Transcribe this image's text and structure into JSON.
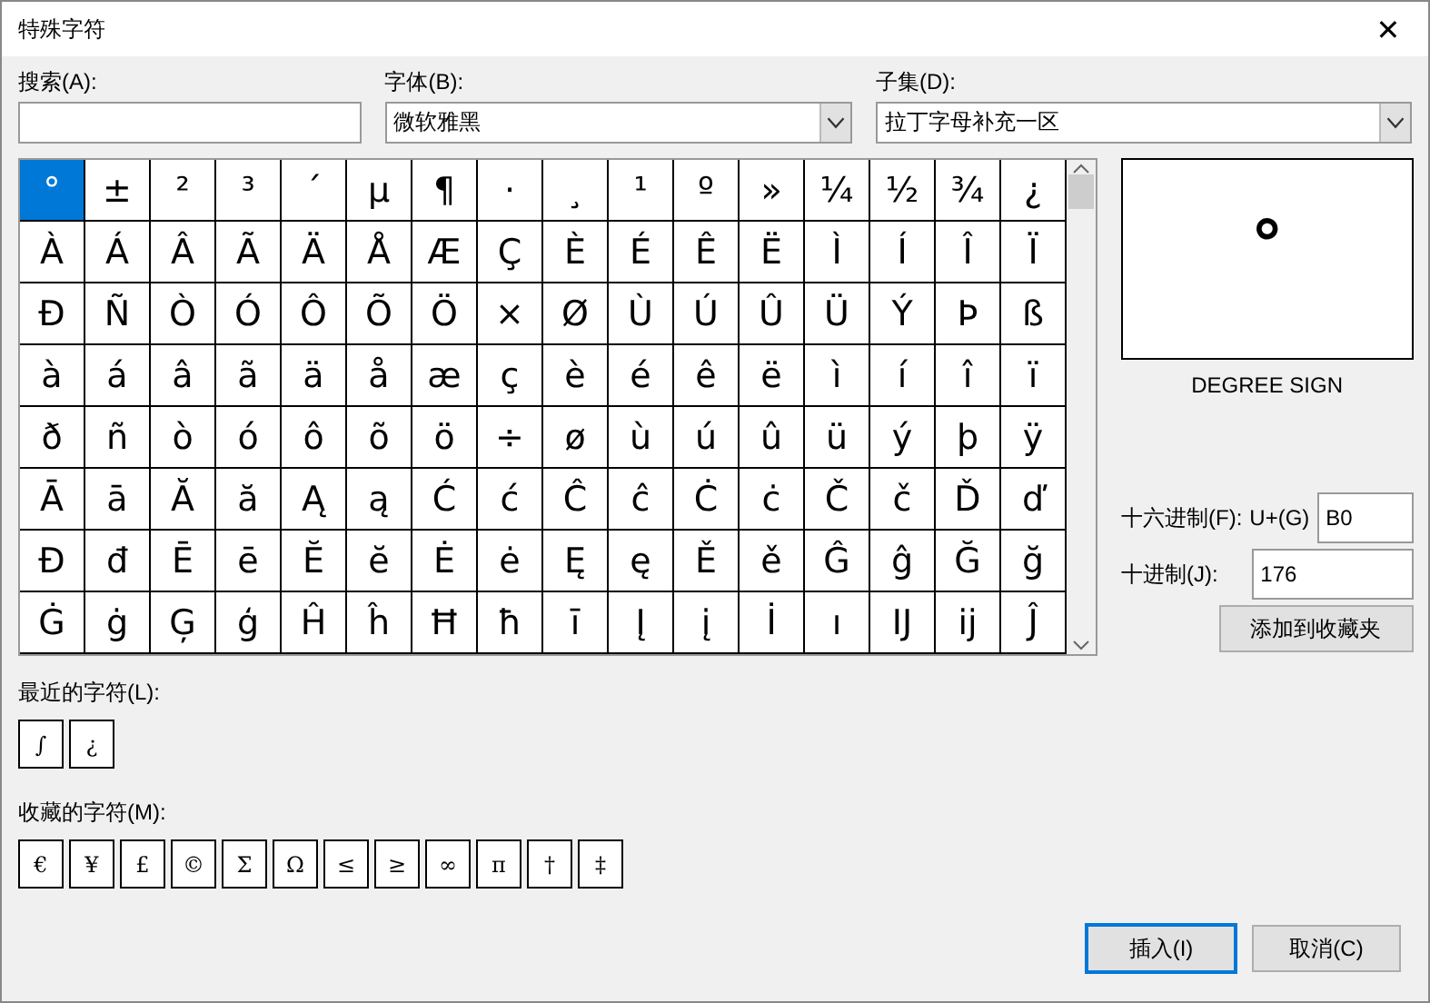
{
  "window": {
    "title": "特殊字符",
    "close": "✕"
  },
  "search": {
    "label": "搜索(A):"
  },
  "font": {
    "label": "字体(B):",
    "value": "微软雅黑"
  },
  "subset": {
    "label": "子集(D):",
    "value": "拉丁字母补充一区"
  },
  "grid": {
    "rows": [
      [
        {
          "char": "°",
          "selected": true
        },
        {
          "char": "±",
          "selected": false
        },
        {
          "char": "²",
          "selected": false
        },
        {
          "char": "³",
          "selected": false
        },
        {
          "char": "´",
          "selected": false
        },
        {
          "char": "µ",
          "selected": false
        },
        {
          "char": "¶",
          "selected": false
        },
        {
          "char": "·",
          "selected": false
        },
        {
          "char": "¸",
          "selected": false
        },
        {
          "char": "¹",
          "selected": false
        },
        {
          "char": "º",
          "selected": false
        },
        {
          "char": "»",
          "selected": false
        },
        {
          "char": "¼",
          "selected": false
        },
        {
          "char": "½",
          "selected": false
        },
        {
          "char": "¾",
          "selected": false
        },
        {
          "char": "¿",
          "selected": false
        }
      ],
      [
        {
          "char": "À",
          "selected": false
        },
        {
          "char": "Á",
          "selected": false
        },
        {
          "char": "Â",
          "selected": false
        },
        {
          "char": "Ã",
          "selected": false
        },
        {
          "char": "Ä",
          "selected": false
        },
        {
          "char": "Å",
          "selected": false
        },
        {
          "char": "Æ",
          "selected": false
        },
        {
          "char": "Ç",
          "selected": false
        },
        {
          "char": "È",
          "selected": false
        },
        {
          "char": "É",
          "selected": false
        },
        {
          "char": "Ê",
          "selected": false
        },
        {
          "char": "Ë",
          "selected": false
        },
        {
          "char": "Ì",
          "selected": false
        },
        {
          "char": "Í",
          "selected": false
        },
        {
          "char": "Î",
          "selected": false
        },
        {
          "char": "Ï",
          "selected": false
        }
      ],
      [
        {
          "char": "Ð",
          "selected": false
        },
        {
          "char": "Ñ",
          "selected": false
        },
        {
          "char": "Ò",
          "selected": false
        },
        {
          "char": "Ó",
          "selected": false
        },
        {
          "char": "Ô",
          "selected": false
        },
        {
          "char": "Õ",
          "selected": false
        },
        {
          "char": "Ö",
          "selected": false
        },
        {
          "char": "×",
          "selected": false
        },
        {
          "char": "Ø",
          "selected": false
        },
        {
          "char": "Ù",
          "selected": false
        },
        {
          "char": "Ú",
          "selected": false
        },
        {
          "char": "Û",
          "selected": false
        },
        {
          "char": "Ü",
          "selected": false
        },
        {
          "char": "Ý",
          "selected": false
        },
        {
          "char": "Þ",
          "selected": false
        },
        {
          "char": "ß",
          "selected": false
        }
      ],
      [
        {
          "char": "à",
          "selected": false
        },
        {
          "char": "á",
          "selected": false
        },
        {
          "char": "â",
          "selected": false
        },
        {
          "char": "ã",
          "selected": false
        },
        {
          "char": "ä",
          "selected": false
        },
        {
          "char": "å",
          "selected": false
        },
        {
          "char": "æ",
          "selected": false
        },
        {
          "char": "ç",
          "selected": false
        },
        {
          "char": "è",
          "selected": false
        },
        {
          "char": "é",
          "selected": false
        },
        {
          "char": "ê",
          "selected": false
        },
        {
          "char": "ë",
          "selected": false
        },
        {
          "char": "ì",
          "selected": false
        },
        {
          "char": "í",
          "selected": false
        },
        {
          "char": "î",
          "selected": false
        },
        {
          "char": "ï",
          "selected": false
        }
      ],
      [
        {
          "char": "ð",
          "selected": false
        },
        {
          "char": "ñ",
          "selected": false
        },
        {
          "char": "ò",
          "selected": false
        },
        {
          "char": "ó",
          "selected": false
        },
        {
          "char": "ô",
          "selected": false
        },
        {
          "char": "õ",
          "selected": false
        },
        {
          "char": "ö",
          "selected": false
        },
        {
          "char": "÷",
          "selected": false
        },
        {
          "char": "ø",
          "selected": false
        },
        {
          "char": "ù",
          "selected": false
        },
        {
          "char": "ú",
          "selected": false
        },
        {
          "char": "û",
          "selected": false
        },
        {
          "char": "ü",
          "selected": false
        },
        {
          "char": "ý",
          "selected": false
        },
        {
          "char": "þ",
          "selected": false
        },
        {
          "char": "ÿ",
          "selected": false
        }
      ],
      [
        {
          "char": "Ā",
          "selected": false
        },
        {
          "char": "ā",
          "selected": false
        },
        {
          "char": "Ă",
          "selected": false
        },
        {
          "char": "ă",
          "selected": false
        },
        {
          "char": "Ą",
          "selected": false
        },
        {
          "char": "ą",
          "selected": false
        },
        {
          "char": "Ć",
          "selected": false
        },
        {
          "char": "ć",
          "selected": false
        },
        {
          "char": "Ĉ",
          "selected": false
        },
        {
          "char": "ĉ",
          "selected": false
        },
        {
          "char": "Ċ",
          "selected": false
        },
        {
          "char": "ċ",
          "selected": false
        },
        {
          "char": "Č",
          "selected": false
        },
        {
          "char": "č",
          "selected": false
        },
        {
          "char": "Ď",
          "selected": false
        },
        {
          "char": "ď",
          "selected": false
        }
      ],
      [
        {
          "char": "Đ",
          "selected": false
        },
        {
          "char": "đ",
          "selected": false
        },
        {
          "char": "Ē",
          "selected": false
        },
        {
          "char": "ē",
          "selected": false
        },
        {
          "char": "Ĕ",
          "selected": false
        },
        {
          "char": "ĕ",
          "selected": false
        },
        {
          "char": "Ė",
          "selected": false
        },
        {
          "char": "ė",
          "selected": false
        },
        {
          "char": "Ę",
          "selected": false
        },
        {
          "char": "ę",
          "selected": false
        },
        {
          "char": "Ě",
          "selected": false
        },
        {
          "char": "ě",
          "selected": false
        },
        {
          "char": "Ĝ",
          "selected": false
        },
        {
          "char": "ĝ",
          "selected": false
        },
        {
          "char": "Ğ",
          "selected": false
        },
        {
          "char": "ğ",
          "selected": false
        }
      ],
      [
        {
          "char": "Ġ",
          "selected": false
        },
        {
          "char": "ġ",
          "selected": false
        },
        {
          "char": "Ģ",
          "selected": false
        },
        {
          "char": "ģ",
          "selected": false
        },
        {
          "char": "Ĥ",
          "selected": false
        },
        {
          "char": "ĥ",
          "selected": false
        },
        {
          "char": "Ħ",
          "selected": false
        },
        {
          "char": "ħ",
          "selected": false
        },
        {
          "char": "ī",
          "selected": false
        },
        {
          "char": "Į",
          "selected": false
        },
        {
          "char": "į",
          "selected": false
        },
        {
          "char": "İ",
          "selected": false
        },
        {
          "char": "ı",
          "selected": false
        },
        {
          "char": "Ĳ",
          "selected": false
        },
        {
          "char": "ĳ",
          "selected": false
        },
        {
          "char": "Ĵ",
          "selected": false
        }
      ]
    ]
  },
  "preview": {
    "char": "°",
    "name": "DEGREE SIGN"
  },
  "hex": {
    "label": "十六进制(F):",
    "prefix": "U+(G)",
    "value": "B0"
  },
  "decimal": {
    "label": "十进制(J):",
    "value": "176"
  },
  "add_favorite_button": "添加到收藏夹",
  "recent": {
    "label": "最近的字符(L):",
    "chars": [
      "∫",
      "¿"
    ]
  },
  "favorites": {
    "label": "收藏的字符(M):",
    "chars": [
      "€",
      "¥",
      "£",
      "©",
      "Σ",
      "Ω",
      "≤",
      "≥",
      "∞",
      "π",
      "†",
      "‡"
    ]
  },
  "buttons": [
    {
      "label": "插入(I)",
      "default": true
    },
    {
      "label": "取消(C)",
      "default": false
    }
  ]
}
